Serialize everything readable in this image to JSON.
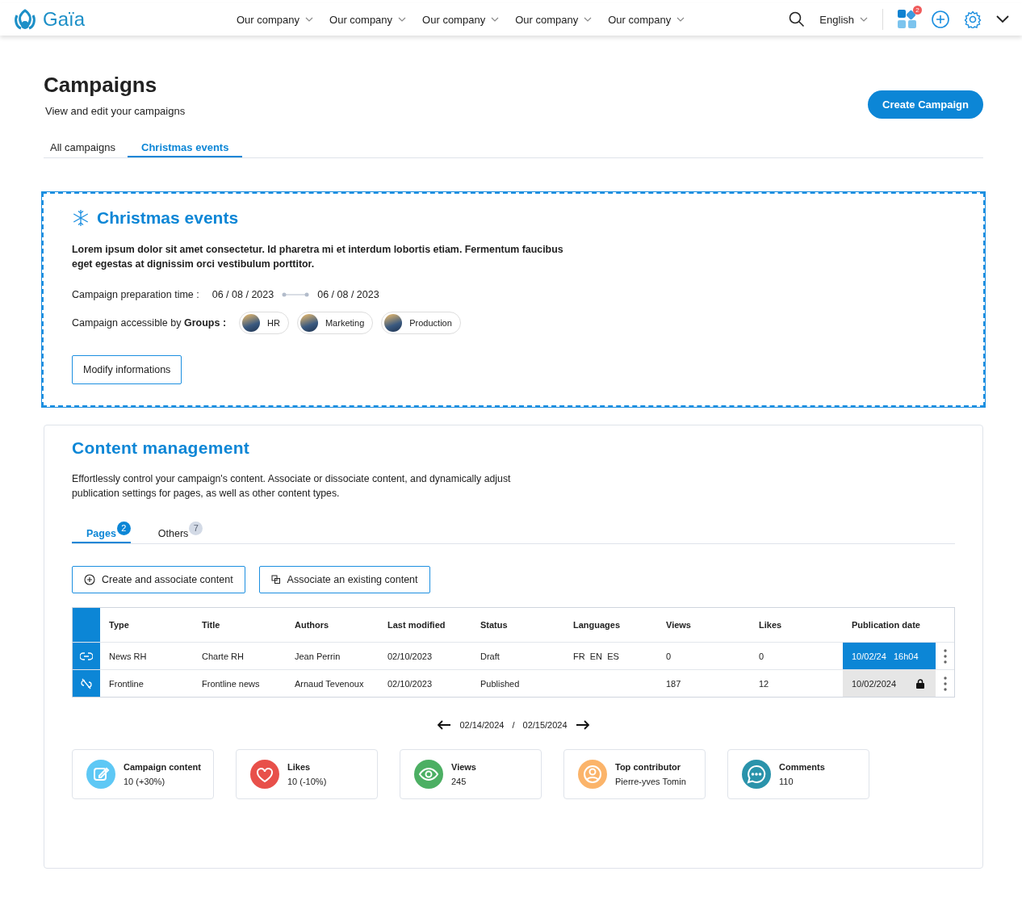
{
  "header": {
    "logo": "Gaïa",
    "nav": [
      "Our company",
      "Our company",
      "Our company",
      "Our company",
      "Our company"
    ],
    "language": "English",
    "apps_badge": "2"
  },
  "page": {
    "title": "Campaigns",
    "subtitle": "View and edit your campaigns",
    "create_button": "Create Campaign",
    "tabs": [
      {
        "label": "All campaigns",
        "selected": false
      },
      {
        "label": "Christmas events",
        "selected": true
      }
    ]
  },
  "event": {
    "title": "Christmas events",
    "description": "Lorem ipsum dolor sit amet consectetur. Id pharetra mi et interdum lobortis etiam. Fermentum faucibus eget egestas at dignissim orci vestibulum porttitor.",
    "prep_label": "Campaign preparation time :",
    "start": "06 / 08 / 2023",
    "end": "06 / 08 / 2023",
    "groups_label": "Campaign accessible by **Groups :**",
    "groups": [
      "HR",
      "Marketing",
      "Production"
    ],
    "modify_button": "Modify informations"
  },
  "content": {
    "title": "Content management",
    "description": "Effortlessly control your campaign's content. Associate or dissociate content, and dynamically adjust publication settings for pages, as well as other content types.",
    "tabs": [
      {
        "label": "Pages",
        "count": "2",
        "selected": true
      },
      {
        "label": "Others",
        "count": "7",
        "selected": false
      }
    ],
    "buttons": [
      {
        "kind": "create",
        "label": "Create and associate content"
      },
      {
        "kind": "associate",
        "label": "Associate an existing content"
      }
    ],
    "table": {
      "columns": [
        "Type",
        "Title",
        "Authors",
        "Last modified",
        "Status",
        "Languages",
        "Views",
        "Likes",
        "Publication date"
      ],
      "rows": [
        {
          "linked": true,
          "cells": [
            "News RH",
            "Charte RH",
            "Jean Perrin",
            "02/10/2023",
            "Draft",
            "FR  EN  ES",
            "0",
            "0"
          ],
          "publication": {
            "date": "10/02/24",
            "time": "16h04",
            "locked": false
          }
        },
        {
          "linked": false,
          "cells": [
            "Frontline",
            "Frontline news",
            "Arnaud Tevenoux",
            "02/10/2023",
            "Published",
            "",
            "187",
            "12"
          ],
          "publication": {
            "date": "10/02/2024",
            "locked": true
          }
        }
      ]
    },
    "date_range": {
      "start": "02/14/2024",
      "separator": "/",
      "end": "02/15/2024"
    },
    "stats": [
      {
        "kind": "edit",
        "color": "#5ec8f5",
        "title": "Campaign content",
        "value": "10 (+30%)"
      },
      {
        "kind": "heart",
        "color": "#e8504a",
        "title": "Likes",
        "value": "10 (-10%)"
      },
      {
        "kind": "eye",
        "color": "#4caf63",
        "title": "Views",
        "value": "245"
      },
      {
        "kind": "user",
        "color": "#fbb46a",
        "title": "Top contributor",
        "value": "Pierre-yves Tomin"
      },
      {
        "kind": "chat",
        "color": "#2a93ab",
        "title": "Comments",
        "value": "110"
      }
    ]
  }
}
